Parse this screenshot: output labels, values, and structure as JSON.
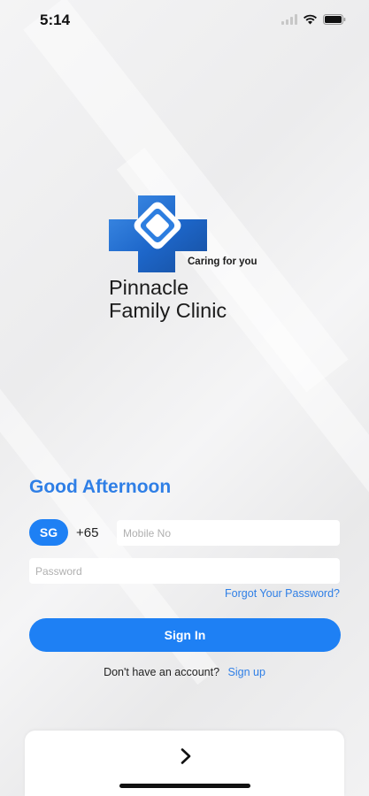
{
  "status_bar": {
    "time": "5:14",
    "icons": [
      "signal-icon",
      "wifi-icon",
      "battery-icon"
    ]
  },
  "logo": {
    "tagline": "Caring for you",
    "name_line1": "Pinnacle",
    "name_line2": "Family Clinic",
    "icon": "medical-cross-logo"
  },
  "login": {
    "greeting": "Good Afternoon",
    "country_code": "SG",
    "dial_code": "+65",
    "mobile_placeholder": "Mobile No",
    "mobile_value": "",
    "password_placeholder": "Password",
    "password_value": "",
    "forgot_password": "Forgot Your Password?",
    "sign_in": "Sign In",
    "no_account": "Don't have an account?",
    "sign_up": "Sign up"
  },
  "bottom_card": {
    "icon": "chevron-right-icon"
  },
  "colors": {
    "accent": "#1e80f4",
    "link": "#2f7fe6",
    "background": "#efeff0"
  }
}
